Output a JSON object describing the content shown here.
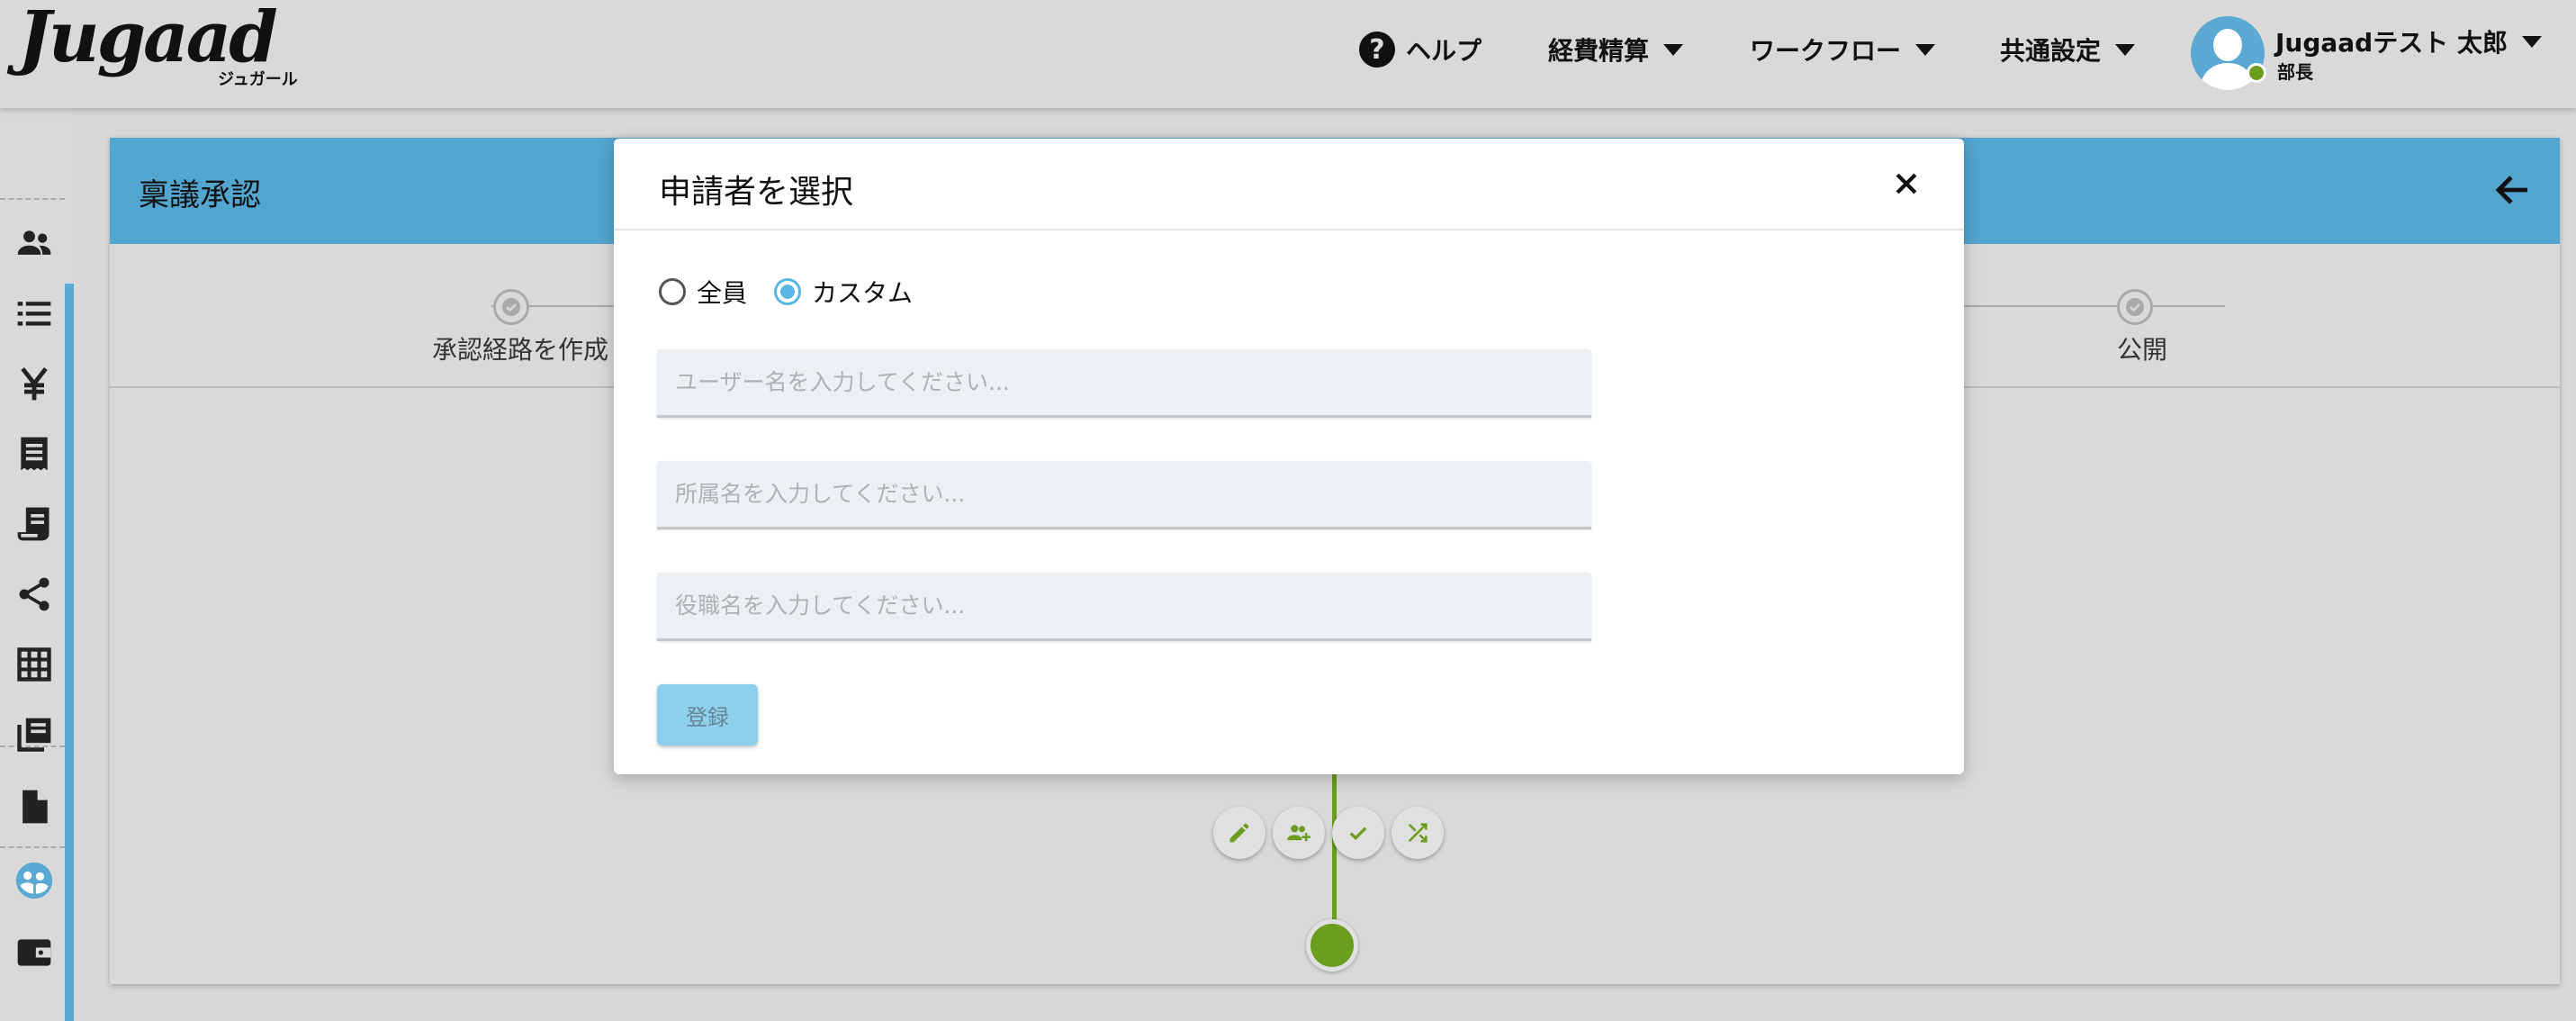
{
  "header": {
    "logo_text": "Jugaad",
    "logo_subtext": "ジュガール",
    "nav": [
      {
        "label": "ヘルプ",
        "icon": "help-icon"
      },
      {
        "label": "経費精算",
        "icon": "caret-down-icon"
      },
      {
        "label": "ワークフロー",
        "icon": "caret-down-icon"
      },
      {
        "label": "共通設定",
        "icon": "caret-down-icon"
      }
    ],
    "user": {
      "name": "Jugaadテスト 太郎",
      "role": "部長",
      "status_color": "#6b9e1f"
    }
  },
  "sidebar": {
    "items": [
      {
        "icon": "users-icon"
      },
      {
        "icon": "list-icon"
      },
      {
        "icon": "yen-icon"
      },
      {
        "icon": "receipt-icon"
      },
      {
        "icon": "document-receipt-icon"
      },
      {
        "icon": "share-icon"
      },
      {
        "icon": "grid-icon"
      },
      {
        "icon": "library-icon"
      },
      {
        "icon": "file-icon"
      },
      {
        "icon": "group-circle-icon",
        "active": true
      },
      {
        "icon": "wallet-icon"
      }
    ],
    "accent_color": "#59a9d2"
  },
  "page": {
    "title": "稟議承認",
    "steps": [
      {
        "label": "承認経路を作成"
      },
      {
        "label": "公開"
      }
    ]
  },
  "flow": {
    "actions": [
      {
        "icon": "edit-icon"
      },
      {
        "icon": "add-user-icon"
      },
      {
        "icon": "check-icon"
      },
      {
        "icon": "shuffle-icon"
      }
    ],
    "color": "#6b9e1f"
  },
  "modal": {
    "title": "申請者を選択",
    "radio_options": [
      {
        "label": "全員",
        "checked": false
      },
      {
        "label": "カスタム",
        "checked": true
      }
    ],
    "fields": [
      {
        "placeholder": "ユーザー名を入力してください...",
        "value": ""
      },
      {
        "placeholder": "所属名を入力してください...",
        "value": ""
      },
      {
        "placeholder": "役職名を入力してください...",
        "value": ""
      }
    ],
    "submit_label": "登録"
  }
}
